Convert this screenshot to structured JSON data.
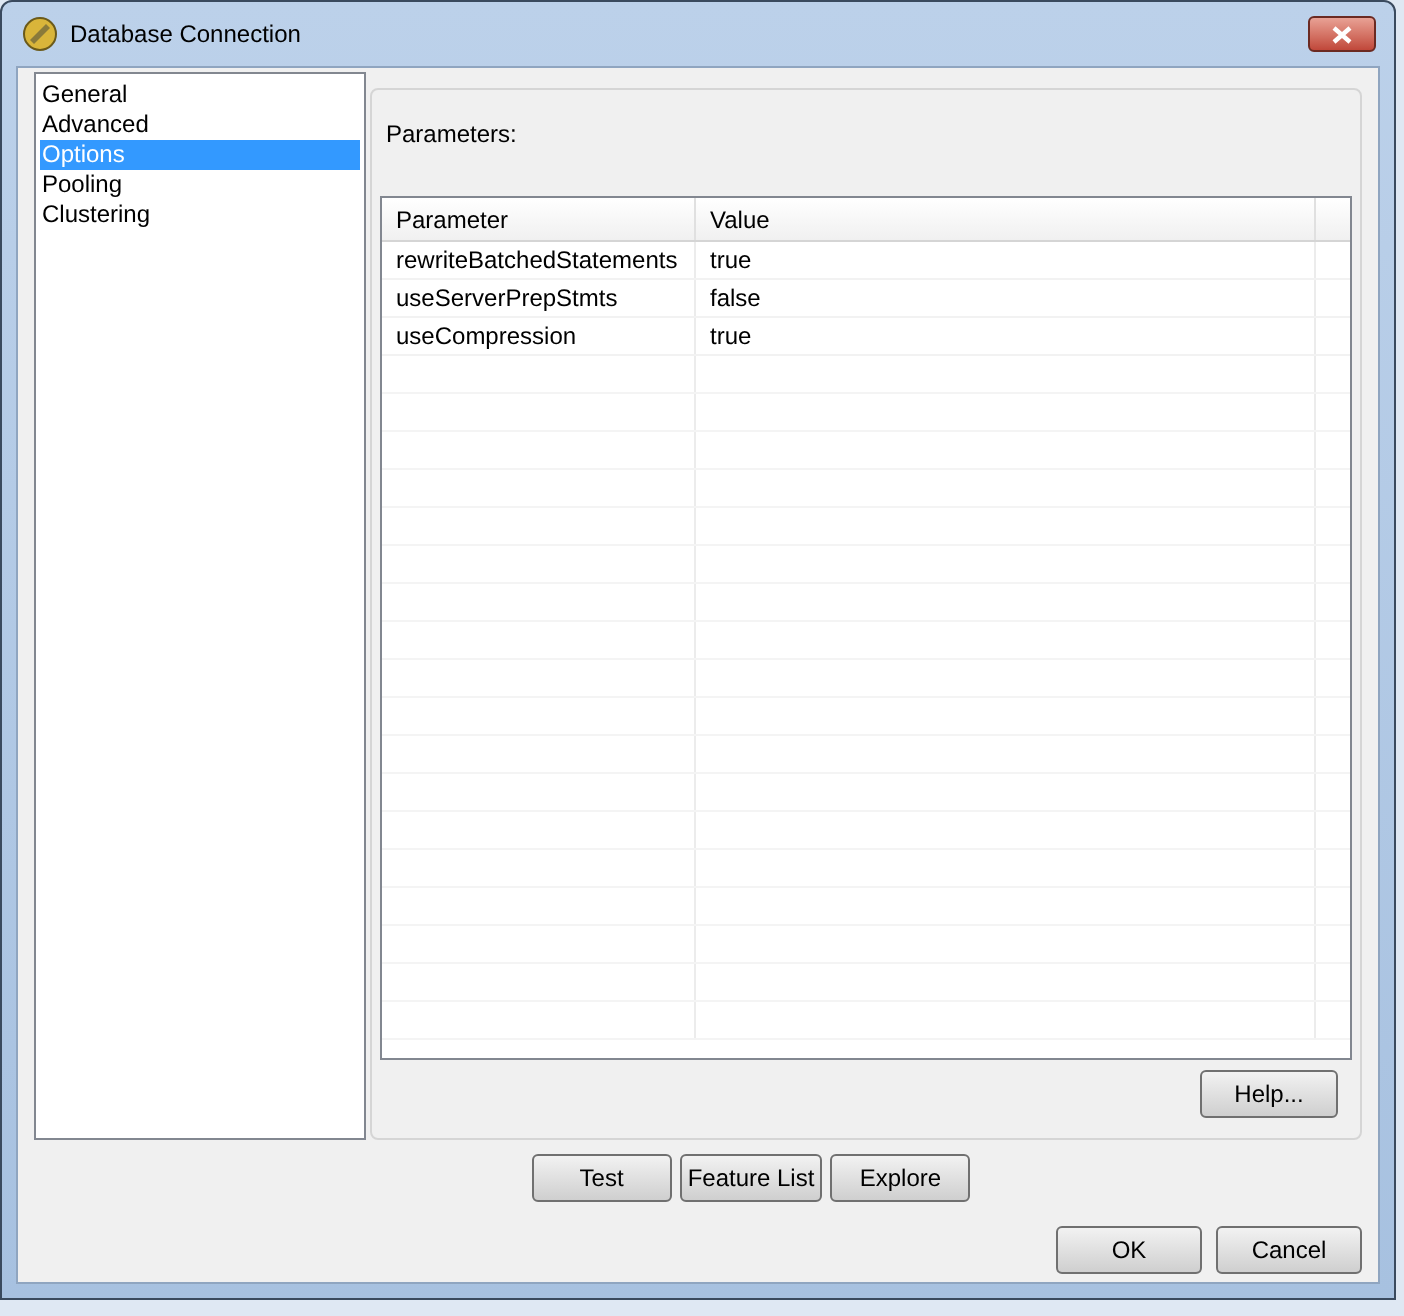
{
  "window": {
    "title": "Database Connection"
  },
  "sidebar": {
    "items": [
      {
        "label": "General",
        "selected": false
      },
      {
        "label": "Advanced",
        "selected": false
      },
      {
        "label": "Options",
        "selected": true
      },
      {
        "label": "Pooling",
        "selected": false
      },
      {
        "label": "Clustering",
        "selected": false
      }
    ]
  },
  "panel": {
    "label": "Parameters:"
  },
  "table": {
    "columns": [
      "Parameter",
      "Value"
    ],
    "rows": [
      [
        "rewriteBatchedStatements",
        "true"
      ],
      [
        "useServerPrepStmts",
        "false"
      ],
      [
        "useCompression",
        "true"
      ]
    ]
  },
  "help_button": "Help...",
  "action_buttons": [
    "Test",
    "Feature List",
    "Explore"
  ],
  "dialog_buttons": [
    "OK",
    "Cancel"
  ]
}
